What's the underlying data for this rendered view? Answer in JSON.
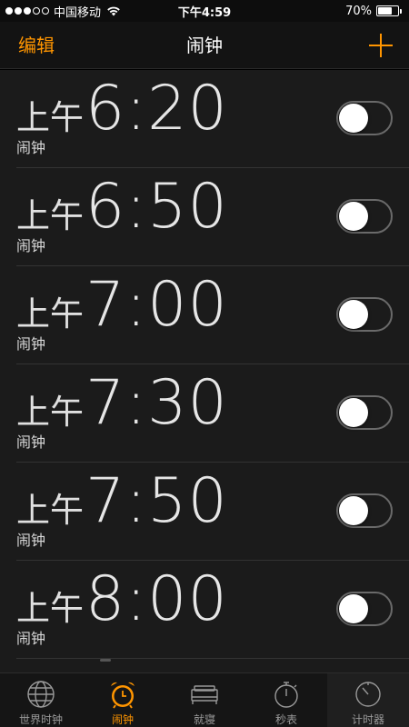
{
  "status_bar": {
    "carrier": "中国移动",
    "time": "下午4:59",
    "battery_percent": "70%",
    "battery_level": 0.7,
    "signal_strength_bars": 3,
    "signal_total_bars": 5
  },
  "nav": {
    "edit_label": "编辑",
    "title": "闹钟",
    "add_icon": "plus-icon"
  },
  "alarms": [
    {
      "period": "上午",
      "time": "6:20",
      "label": "闹钟",
      "enabled": false
    },
    {
      "period": "上午",
      "time": "6:50",
      "label": "闹钟",
      "enabled": false
    },
    {
      "period": "上午",
      "time": "7:00",
      "label": "闹钟",
      "enabled": false
    },
    {
      "period": "上午",
      "time": "7:30",
      "label": "闹钟",
      "enabled": false
    },
    {
      "period": "上午",
      "time": "7:50",
      "label": "闹钟",
      "enabled": false
    },
    {
      "period": "上午",
      "time": "8:00",
      "label": "闹钟",
      "enabled": false
    }
  ],
  "tabs": [
    {
      "label": "世界时钟",
      "icon": "globe-icon",
      "active": false
    },
    {
      "label": "闹钟",
      "icon": "alarm-clock-icon",
      "active": true
    },
    {
      "label": "就寝",
      "icon": "bed-icon",
      "active": false
    },
    {
      "label": "秒表",
      "icon": "stopwatch-icon",
      "active": false
    },
    {
      "label": "计时器",
      "icon": "timer-icon",
      "active": false
    }
  ],
  "colors": {
    "accent": "#ff9500",
    "background": "#1b1b1b",
    "inactive_tab": "#9a9a9a"
  }
}
